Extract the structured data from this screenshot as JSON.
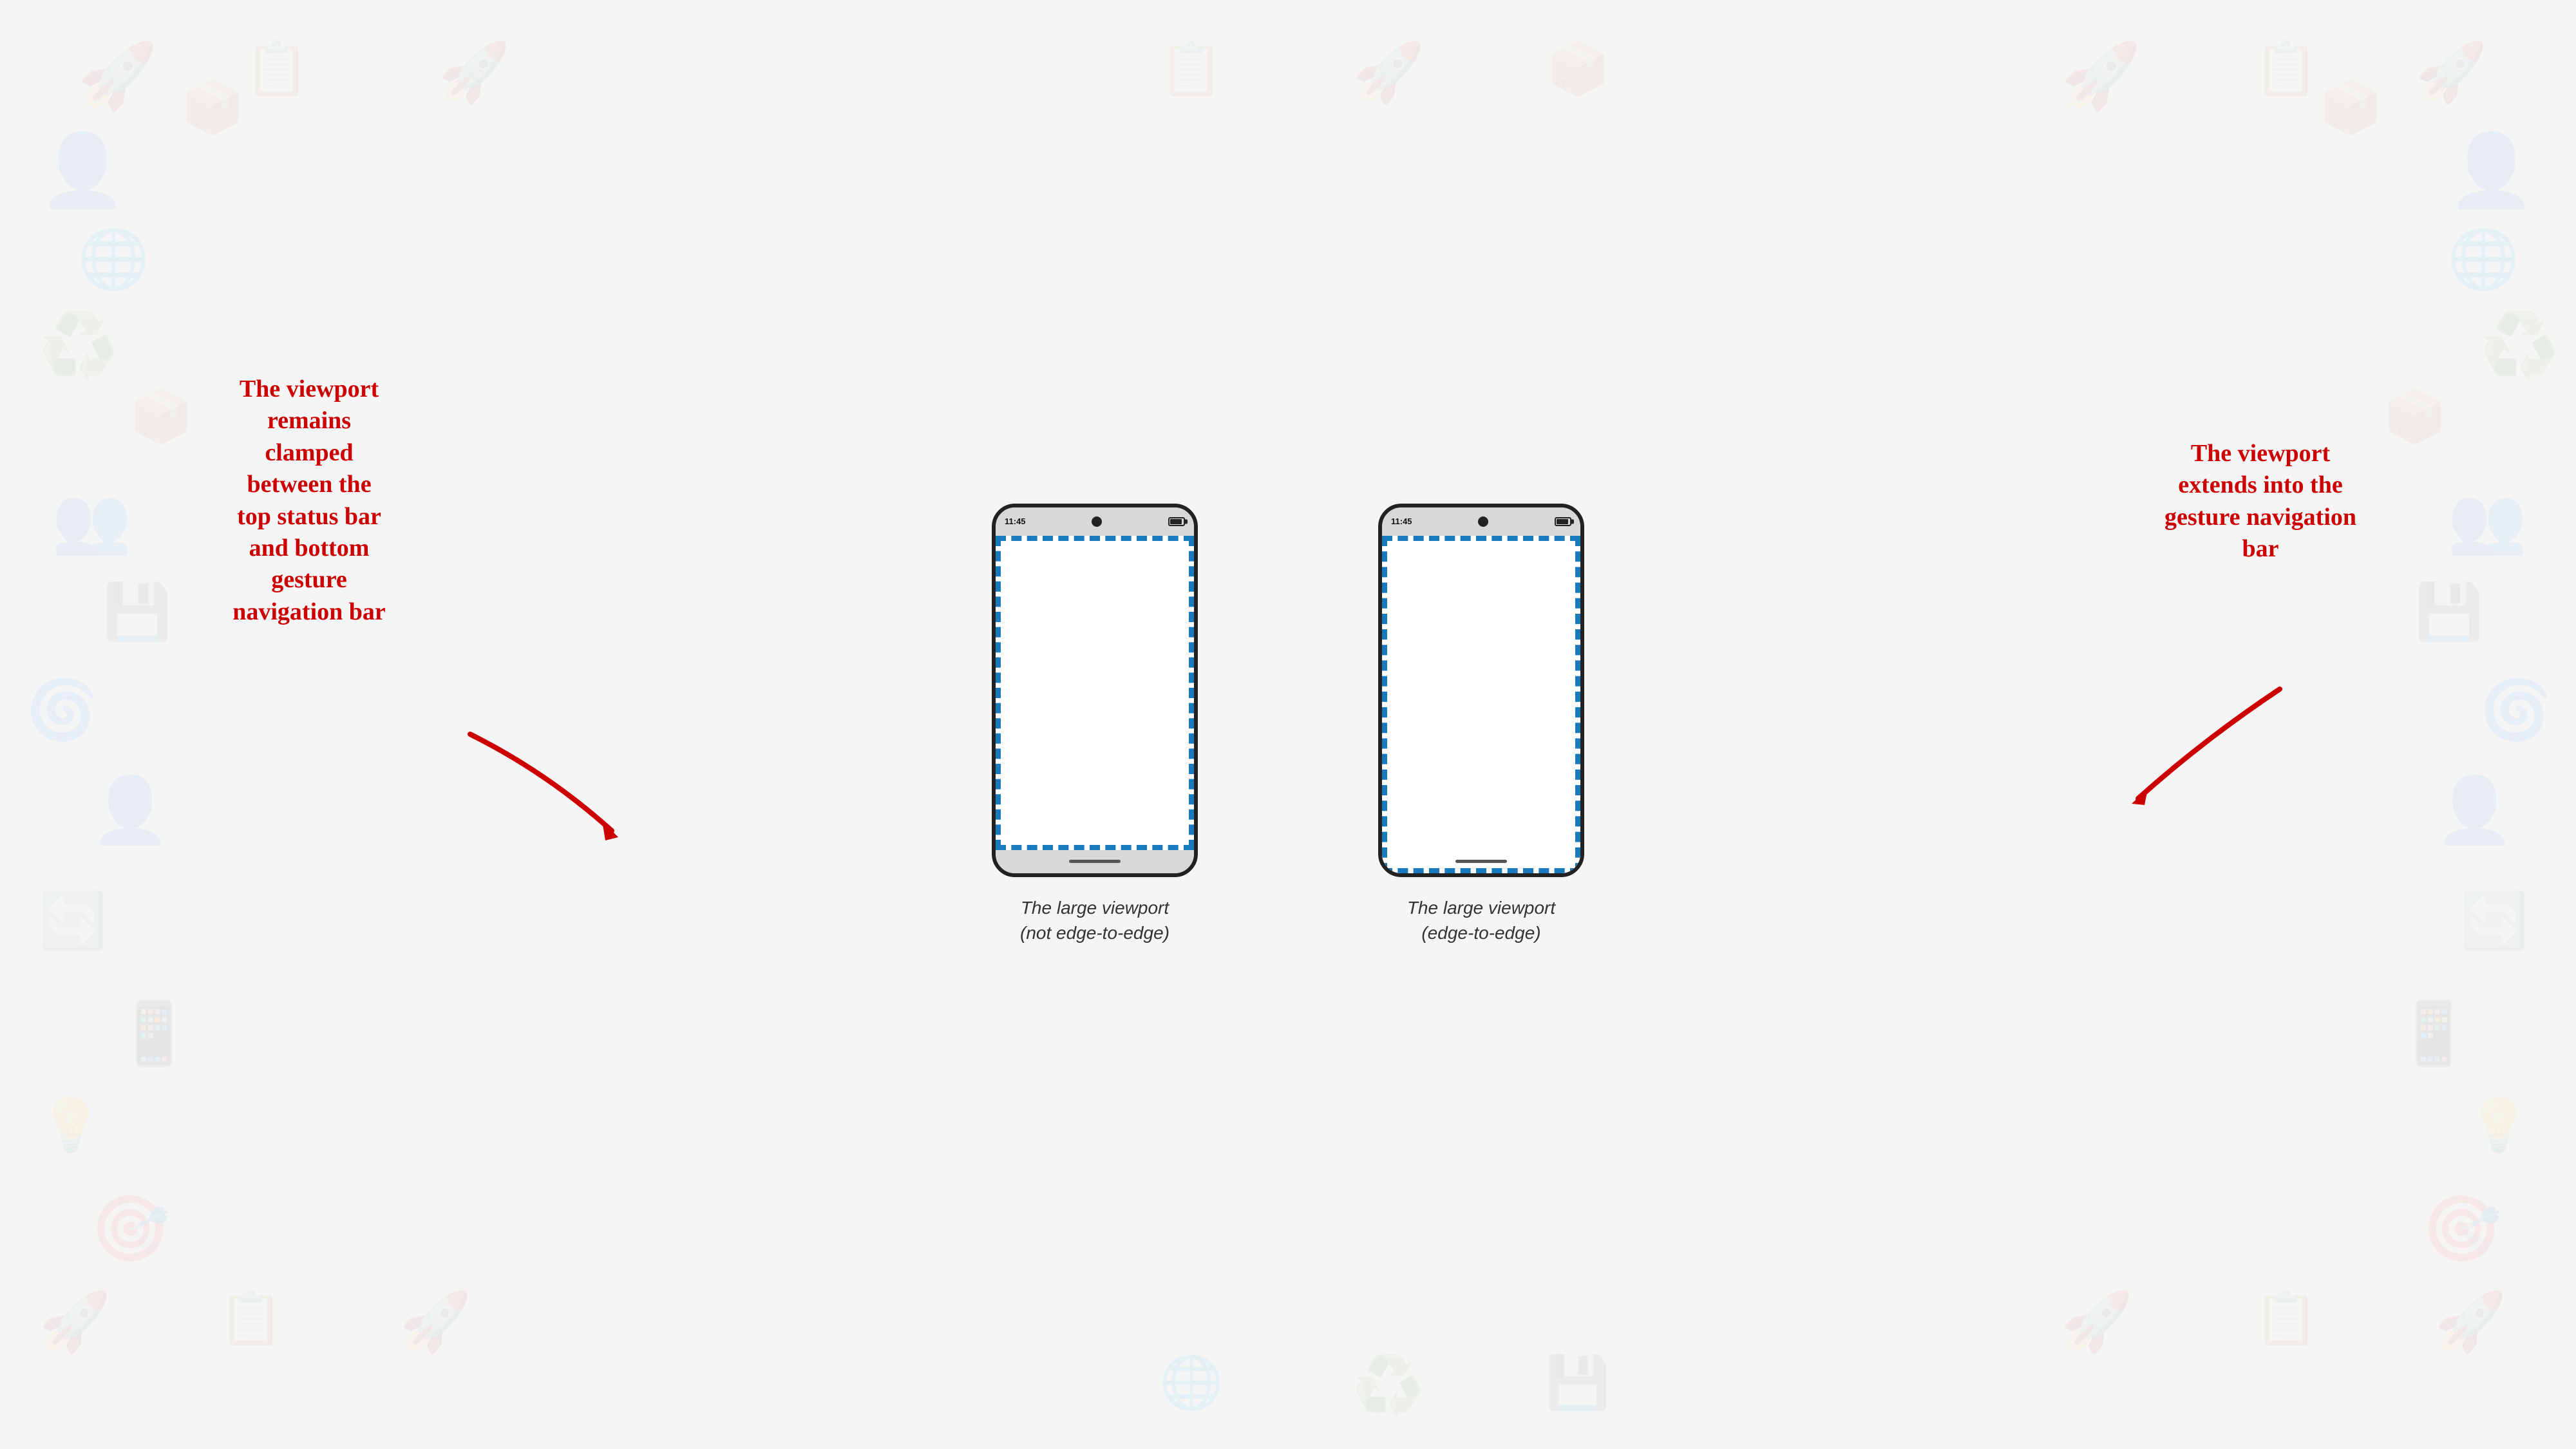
{
  "background": {
    "color": "#f0f0f0"
  },
  "left_phone": {
    "time": "11:45",
    "type": "not-edge",
    "label_line1": "The large viewport",
    "label_line2": "(not edge-to-edge)"
  },
  "right_phone": {
    "time": "11:45",
    "type": "edge",
    "label_line1": "The large viewport",
    "label_line2": "(edge-to-edge)"
  },
  "left_annotation": {
    "text": "The viewport\nremains\nclamped\nbetween the\ntop status bar\nand bottom\ngesture\nnavigation bar"
  },
  "right_annotation": {
    "text": "The viewport\nextends into the\ngesture navigation\nbar"
  }
}
